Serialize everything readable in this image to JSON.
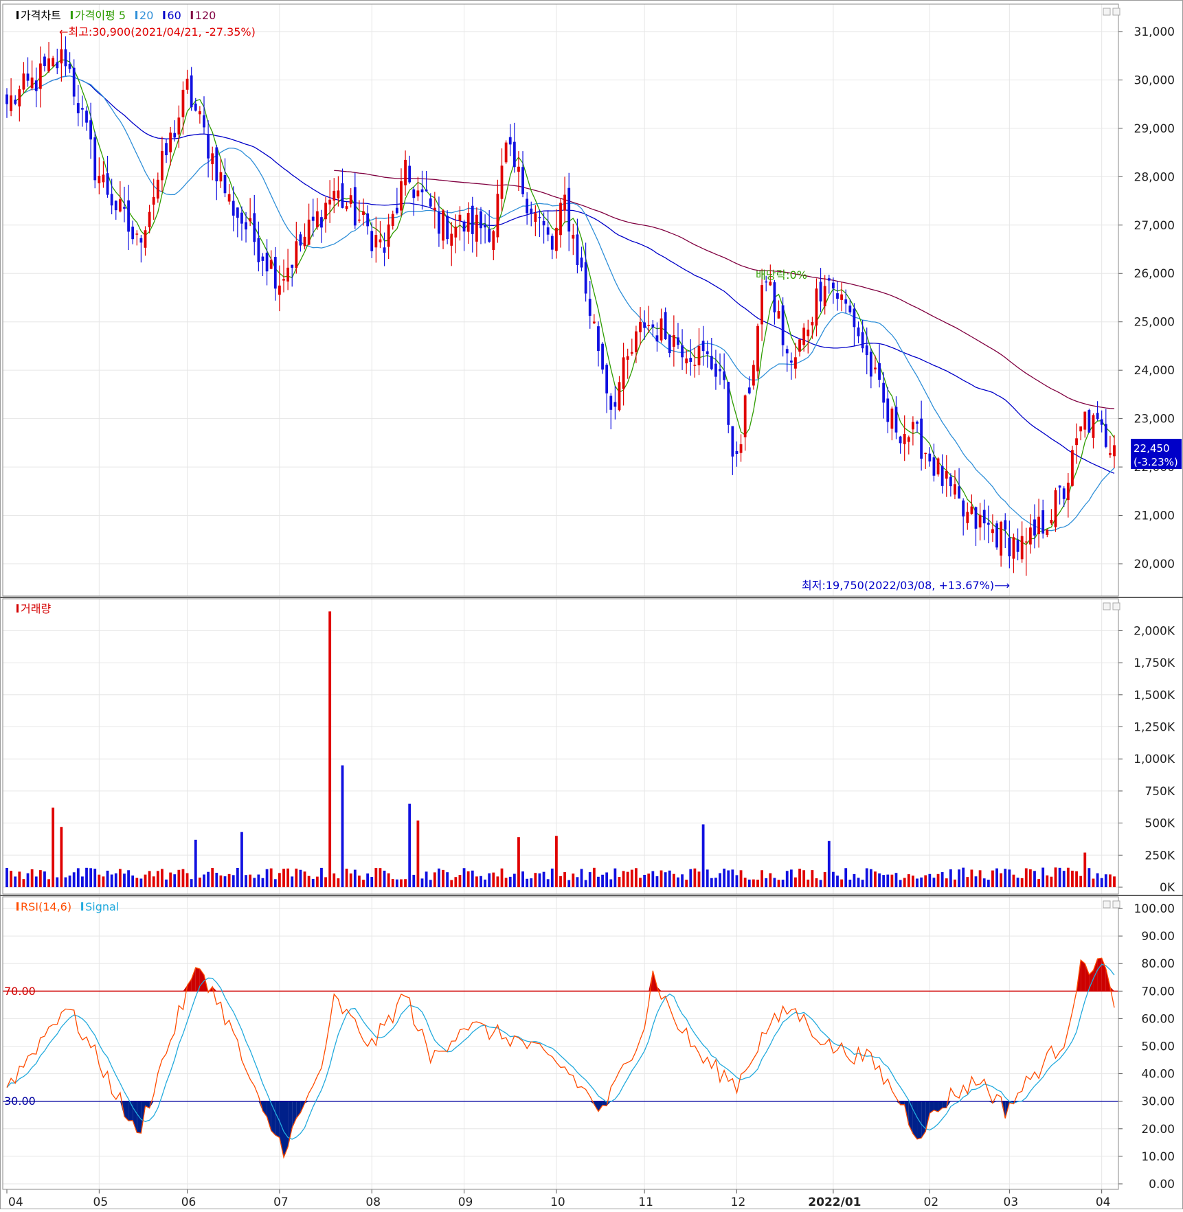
{
  "panels": {
    "price": {
      "legend": [
        {
          "label": "가격차트",
          "color": "#000000"
        },
        {
          "label": "가격이평 5",
          "color": "#2e9c00"
        },
        {
          "label": "20",
          "color": "#2f8fd8"
        },
        {
          "label": "60",
          "color": "#0000c8"
        },
        {
          "label": "120",
          "color": "#800040"
        }
      ],
      "high_annotation": "←최고:30,900(2021/04/21, -27.35%)",
      "low_annotation": "최저:19,750(2022/03/08, +13.67%)⟶",
      "dividend_annotation": "배당락:0%",
      "last_price": "22,450",
      "last_change": "(-3.23%)",
      "y_ticks": [
        "31,000",
        "30,000",
        "29,000",
        "28,000",
        "27,000",
        "26,000",
        "25,000",
        "24,000",
        "23,000",
        "22,000",
        "21,000",
        "20,000"
      ]
    },
    "volume": {
      "legend": [
        {
          "label": "거래량",
          "color": "#d40000"
        }
      ],
      "y_ticks": [
        "2,000K",
        "1,750K",
        "1,500K",
        "1,250K",
        "1,000K",
        "750K",
        "500K",
        "250K",
        "0K"
      ]
    },
    "rsi": {
      "legend": [
        {
          "label": "RSI(14,6)",
          "color": "#ff4c00"
        },
        {
          "label": "Signal",
          "color": "#22aadd"
        }
      ],
      "upper_label": "70.00",
      "lower_label": "30.00",
      "y_ticks": [
        "100.00",
        "90.00",
        "80.00",
        "70.00",
        "60.00",
        "50.00",
        "40.00",
        "30.00",
        "20.00",
        "10.00",
        "0.00"
      ]
    },
    "x_ticks": [
      "04",
      "05",
      "06",
      "07",
      "08",
      "09",
      "10",
      "11",
      "12",
      "2022/01",
      "02",
      "03",
      "04"
    ]
  },
  "colors": {
    "up": "#e00000",
    "down": "#1010e0",
    "ma5": "#2e9c00",
    "ma20": "#2f8fd8",
    "ma60": "#0000c8",
    "ma120": "#800040",
    "rsi": "#ff4c00",
    "signal": "#22aadd"
  },
  "chart_data": [
    {
      "type": "candlestick",
      "title": "가격차트",
      "ylim": [
        19500,
        31500
      ],
      "series_names": [
        "가격이평 5",
        "20",
        "60",
        "120"
      ],
      "anchors": [
        {
          "date": "2021/04/01",
          "close": 29500
        },
        {
          "date": "2021/04/21",
          "close": 30500,
          "high": 30900
        },
        {
          "date": "2021/05/01",
          "close": 28200
        },
        {
          "date": "2021/05/15",
          "close": 26600
        },
        {
          "date": "2021/06/01",
          "close": 29800
        },
        {
          "date": "2021/06/15",
          "close": 27500
        },
        {
          "date": "2021/07/01",
          "close": 25900
        },
        {
          "date": "2021/07/20",
          "close": 27700
        },
        {
          "date": "2021/08/05",
          "close": 26500
        },
        {
          "date": "2021/08/12",
          "close": 28000
        },
        {
          "date": "2021/08/25",
          "close": 27000
        },
        {
          "date": "2021/09/10",
          "close": 27000
        },
        {
          "date": "2021/09/15",
          "close": 28500
        },
        {
          "date": "2021/09/30",
          "close": 26500
        },
        {
          "date": "2021/10/05",
          "close": 27500
        },
        {
          "date": "2021/10/15",
          "close": 24500
        },
        {
          "date": "2021/10/20",
          "close": 23300
        },
        {
          "date": "2021/11/01",
          "close": 25000
        },
        {
          "date": "2021/11/15",
          "close": 24500
        },
        {
          "date": "2021/11/25",
          "close": 24000
        },
        {
          "date": "2021/12/01",
          "close": 22000
        },
        {
          "date": "2021/12/10",
          "close": 26000
        },
        {
          "date": "2021/12/20",
          "close": 24000
        },
        {
          "date": "2021/12/30",
          "close": 26000
        },
        {
          "date": "2022/01/10",
          "close": 25000
        },
        {
          "date": "2022/01/20",
          "close": 23000
        },
        {
          "date": "2022/02/01",
          "close": 22500
        },
        {
          "date": "2022/02/15",
          "close": 21000
        },
        {
          "date": "2022/03/08",
          "close": 20300,
          "low": 19750
        },
        {
          "date": "2022/03/20",
          "close": 21500
        },
        {
          "date": "2022/03/28",
          "close": 23000
        },
        {
          "date": "2022/04/06",
          "close": 22450
        }
      ],
      "last": {
        "close": 22450,
        "change_pct": -3.23
      }
    },
    {
      "type": "bar",
      "title": "거래량",
      "ylim": [
        0,
        2000000
      ],
      "typical_volume": 110000,
      "spikes": [
        {
          "date": "2021/04/17",
          "volume": 620000
        },
        {
          "date": "2021/04/20",
          "volume": 470000
        },
        {
          "date": "2021/06/03",
          "volume": 370000
        },
        {
          "date": "2021/06/19",
          "volume": 430000
        },
        {
          "date": "2021/07/19",
          "volume": 2150000
        },
        {
          "date": "2021/07/22",
          "volume": 950000
        },
        {
          "date": "2021/08/14",
          "volume": 650000
        },
        {
          "date": "2021/08/17",
          "volume": 520000
        },
        {
          "date": "2021/09/20",
          "volume": 390000
        },
        {
          "date": "2021/10/02",
          "volume": 400000
        },
        {
          "date": "2021/11/20",
          "volume": 490000
        },
        {
          "date": "2022/01/01",
          "volume": 360000
        },
        {
          "date": "2022/03/28",
          "volume": 270000
        }
      ]
    },
    {
      "type": "line",
      "title": "RSI(14,6)",
      "ylim": [
        0,
        100
      ],
      "upper_threshold": 70,
      "lower_threshold": 30,
      "series": [
        {
          "name": "RSI(14,6)",
          "points": [
            {
              "date": "2021/04/01",
              "value": 35
            },
            {
              "date": "2021/04/21",
              "value": 65
            },
            {
              "date": "2021/05/01",
              "value": 47
            },
            {
              "date": "2021/05/10",
              "value": 30
            },
            {
              "date": "2021/05/15",
              "value": 17
            },
            {
              "date": "2021/05/20",
              "value": 35
            },
            {
              "date": "2021/06/01",
              "value": 70
            },
            {
              "date": "2021/06/05",
              "value": 79
            },
            {
              "date": "2021/06/15",
              "value": 58
            },
            {
              "date": "2021/06/25",
              "value": 25
            },
            {
              "date": "2021/07/02",
              "value": 13
            },
            {
              "date": "2021/07/10",
              "value": 28
            },
            {
              "date": "2021/07/17",
              "value": 47
            },
            {
              "date": "2021/07/20",
              "value": 67
            },
            {
              "date": "2021/08/01",
              "value": 50
            },
            {
              "date": "2021/08/12",
              "value": 69
            },
            {
              "date": "2021/08/20",
              "value": 45
            },
            {
              "date": "2021/09/01",
              "value": 58
            },
            {
              "date": "2021/09/20",
              "value": 52
            },
            {
              "date": "2021/10/05",
              "value": 42
            },
            {
              "date": "2021/10/18",
              "value": 26
            },
            {
              "date": "2021/11/01",
              "value": 58
            },
            {
              "date": "2021/11/03",
              "value": 76
            },
            {
              "date": "2021/11/10",
              "value": 60
            },
            {
              "date": "2021/11/20",
              "value": 45
            },
            {
              "date": "2021/12/01",
              "value": 36
            },
            {
              "date": "2021/12/10",
              "value": 56
            },
            {
              "date": "2021/12/20",
              "value": 64
            },
            {
              "date": "2022/01/01",
              "value": 50
            },
            {
              "date": "2022/01/15",
              "value": 45
            },
            {
              "date": "2022/01/25",
              "value": 30
            },
            {
              "date": "2022/01/31",
              "value": 18
            },
            {
              "date": "2022/02/10",
              "value": 32
            },
            {
              "date": "2022/02/20",
              "value": 38
            },
            {
              "date": "2022/03/01",
              "value": 27
            },
            {
              "date": "2022/03/10",
              "value": 40
            },
            {
              "date": "2022/03/20",
              "value": 52
            },
            {
              "date": "2022/03/25",
              "value": 78
            },
            {
              "date": "2022/04/01",
              "value": 81
            },
            {
              "date": "2022/04/06",
              "value": 64
            }
          ]
        },
        {
          "name": "Signal",
          "smoothing": 6
        }
      ]
    }
  ]
}
